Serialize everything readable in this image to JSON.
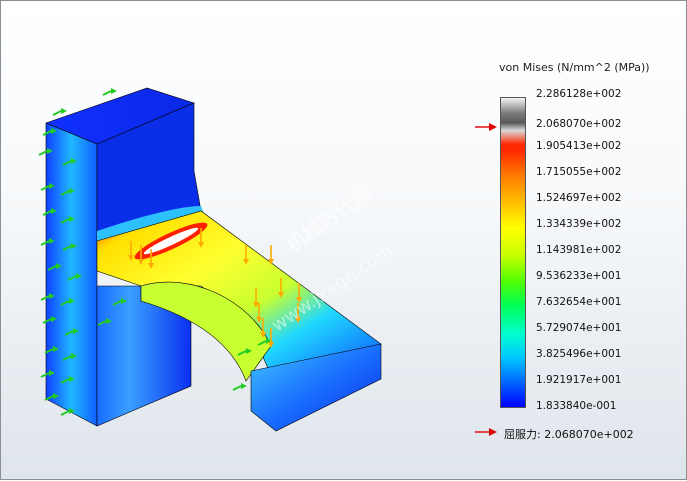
{
  "legend": {
    "title": "von Mises (N/mm^2 (MPa))",
    "ticks": [
      "2.286128e+002",
      "2.068070e+002",
      "1.905413e+002",
      "1.715055e+002",
      "1.524697e+002",
      "1.334339e+002",
      "1.143981e+002",
      "9.536233e+001",
      "7.632654e+001",
      "5.729074e+001",
      "3.825496e+001",
      "1.921917e+001",
      "1.833840e-001"
    ],
    "max_value": 228.6128,
    "min_value": 0.183384,
    "yield_value": 206.807
  },
  "yield": {
    "label": "屈服力:",
    "value": "2.068070e+002"
  },
  "watermark": {
    "text": "机械时代网",
    "url": "www.jxage.com"
  },
  "colors": {
    "marker": "#e00000",
    "fixture": "#22cc22",
    "load": "#ffaa00"
  }
}
